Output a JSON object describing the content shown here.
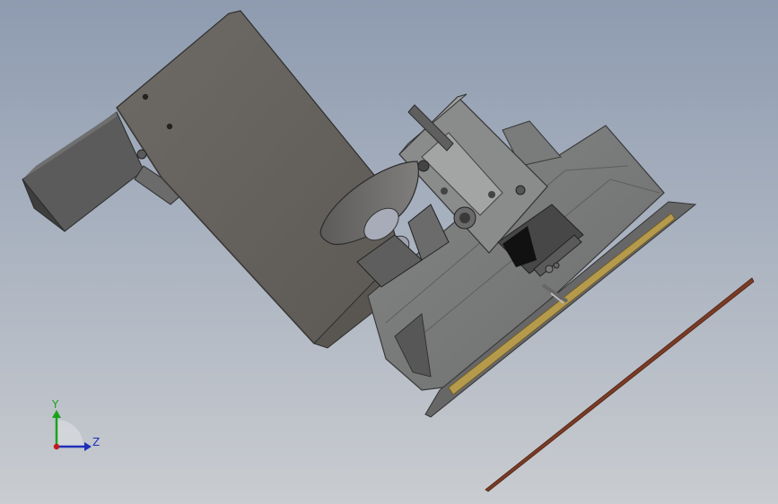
{
  "viewport": {
    "background_top": "#8e9bb0",
    "background_bottom": "#c9ccd0"
  },
  "triad": {
    "y_label": "Y",
    "z_label": "Z",
    "y_color": "#1aa31a",
    "z_color": "#1f2fb8",
    "x_color": "#c41a1a"
  },
  "model": {
    "main_plate_color": "#66625e",
    "housing_color": "#7b7c7c",
    "dark_metal_color": "#3f3f3f",
    "brass_strip_color": "#b59a4c",
    "wire_color": "#7a3b25"
  }
}
